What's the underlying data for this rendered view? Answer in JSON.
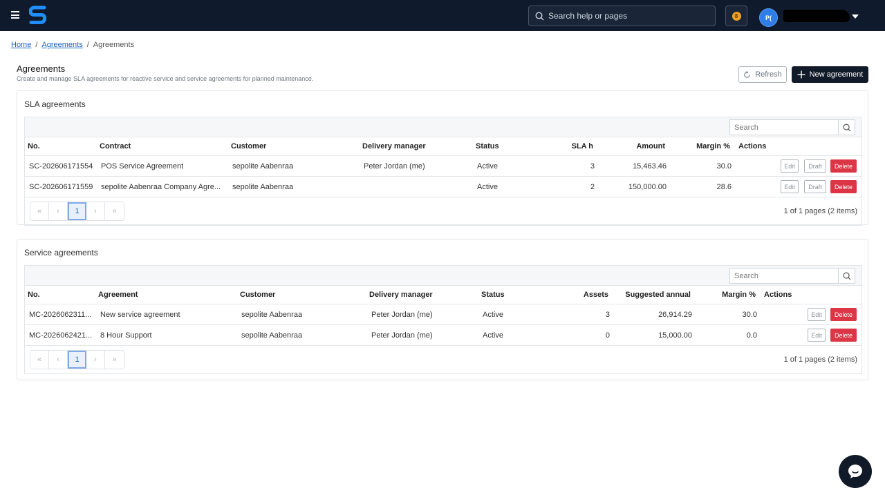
{
  "app": {
    "avatar_initials": "P(",
    "search_placeholder": "Search help or pages",
    "notification_count": "8"
  },
  "breadcrumb": {
    "items": [
      "Home",
      "Agreements",
      "Agreements"
    ]
  },
  "page": {
    "title": "Agreements",
    "subtitle": "Create and manage SLA agreements for reactive service and service agreements for planned maintenance.",
    "refresh_label": "Refresh",
    "new_label": "New agreement"
  },
  "sla": {
    "title": "SLA agreements",
    "search_placeholder": "Search",
    "columns": [
      "No.",
      "Contract",
      "Customer",
      "Delivery manager",
      "Status",
      "SLA h",
      "Amount",
      "Margin %",
      "Actions"
    ],
    "rows": [
      {
        "no": "SC-202606171554",
        "contract": "POS Service Agreement",
        "customer": "sepolite Aabenraa",
        "manager": "Peter Jordan (me)",
        "status": "Active",
        "sla_h": "3",
        "amount": "15,463.46",
        "margin": "30.0"
      },
      {
        "no": "SC-202606171559",
        "contract": "sepolite Aabenraa Company Agre...",
        "customer": "sepolite Aabenraa",
        "manager": "",
        "status": "Active",
        "sla_h": "2",
        "amount": "150,000.00",
        "margin": "28.6"
      }
    ],
    "pager_info": "1 of 1 pages (2 items)",
    "current_page": "1"
  },
  "service": {
    "title": "Service agreements",
    "search_placeholder": "Search",
    "columns": [
      "No.",
      "Agreement",
      "Customer",
      "Delivery manager",
      "Status",
      "Assets",
      "Suggested annual",
      "Margin %",
      "Actions"
    ],
    "rows": [
      {
        "no": "MC-2026062311...",
        "agreement": "New service agreement",
        "customer": "sepolite Aabenraa",
        "manager": "Peter Jordan (me)",
        "status": "Active",
        "assets": "3",
        "annual": "26,914.29",
        "margin": "30.0"
      },
      {
        "no": "MC-2026062421...",
        "agreement": "8 Hour Support",
        "customer": "sepolite Aabenraa",
        "manager": "Peter Jordan (me)",
        "status": "Active",
        "assets": "0",
        "annual": "15,000.00",
        "margin": "0.0"
      }
    ],
    "pager_info": "1 of 1 pages (2 items)",
    "current_page": "1"
  },
  "actions": {
    "edit": "Edit",
    "draft": "Draft",
    "delete": "Delete"
  },
  "pager_glyphs": {
    "first": "«",
    "prev": "‹",
    "next": "›",
    "last": "»"
  },
  "colors": {
    "topbar": "#0f1b2d",
    "primary_dark": "#111a28",
    "danger": "#dc3545",
    "link": "#1a63c5",
    "avatar": "#2f7ee8",
    "badge": "#f0a020"
  },
  "icons": {
    "menu": "hamburger-icon",
    "logo": "s-logo",
    "search": "magnifier-icon",
    "refresh": "refresh-icon",
    "add": "plus-icon",
    "chat": "chat-bubble-icon",
    "dropdown": "caret-down-icon"
  }
}
